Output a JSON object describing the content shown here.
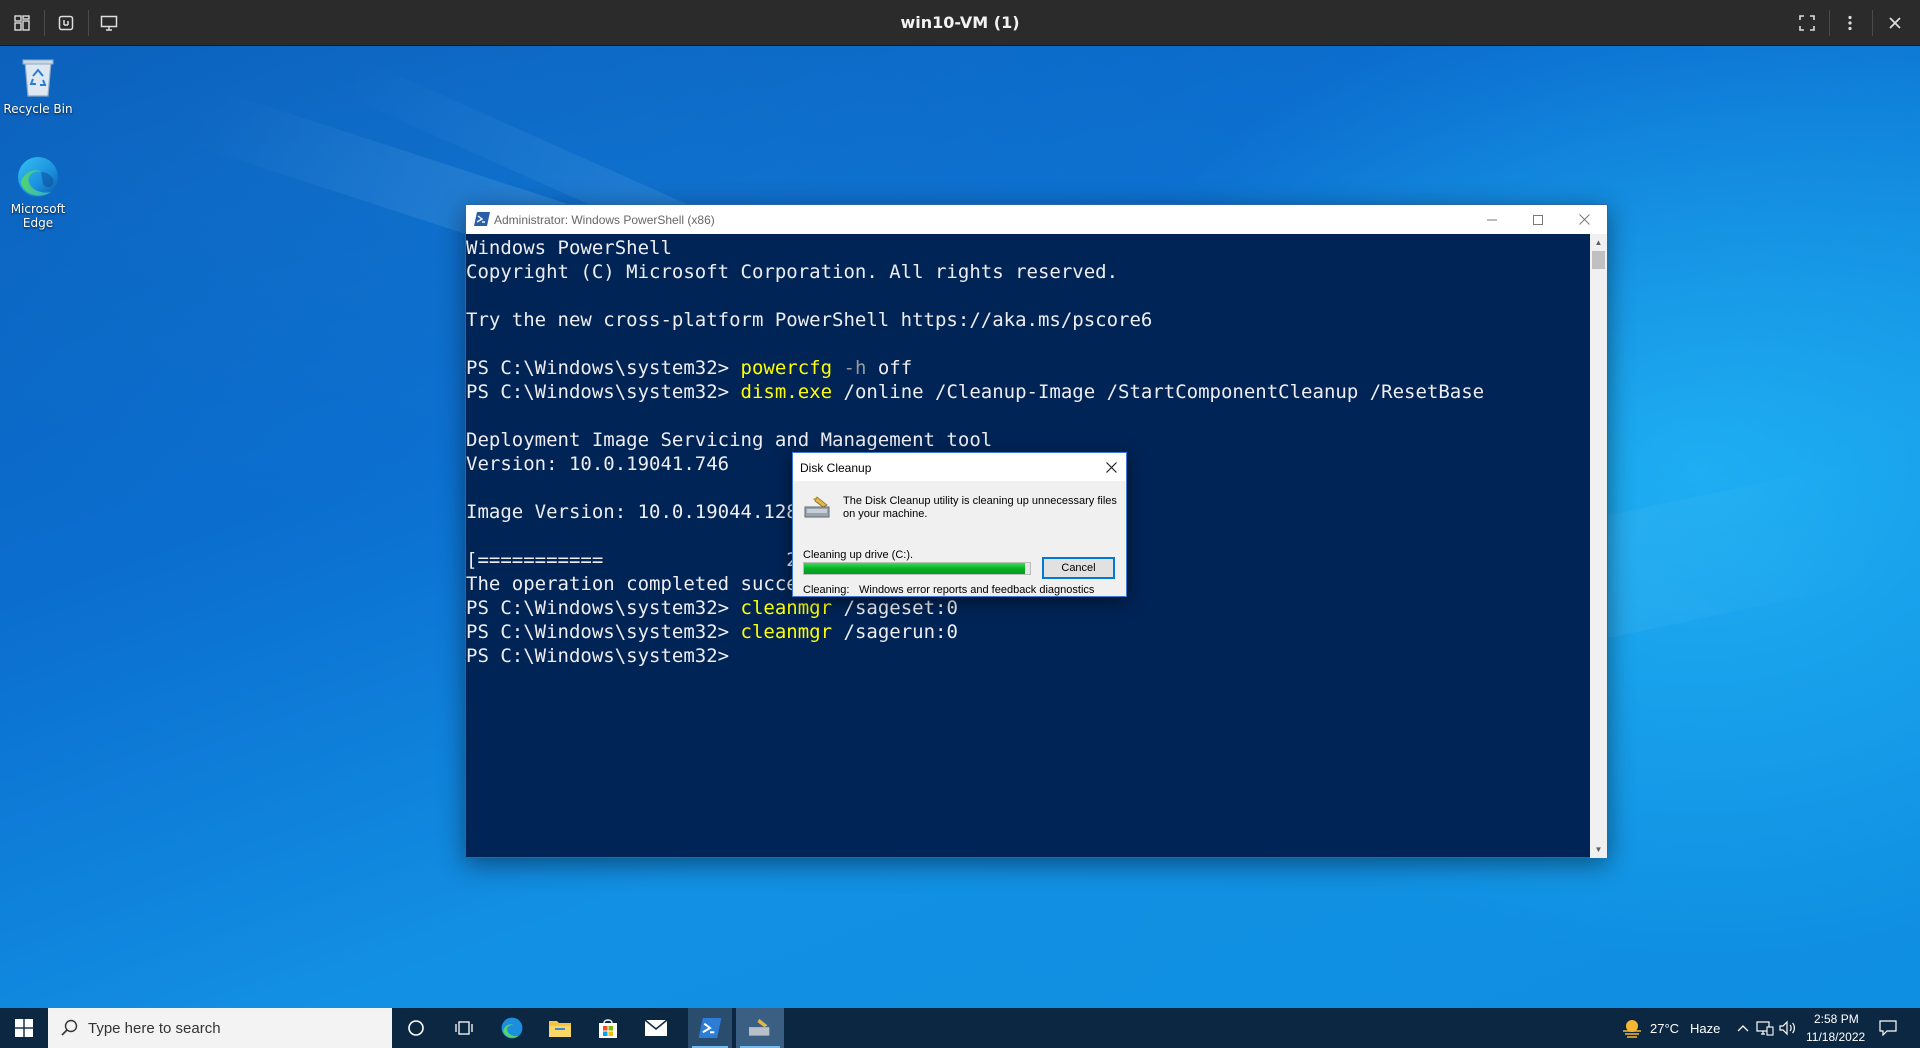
{
  "vm_bar": {
    "title": "win10-VM (1)",
    "left_icons": [
      "dashboard-icon",
      "keyboard-icon",
      "monitor-icon"
    ],
    "right_icons": [
      "fullscreen-icon",
      "more-icon",
      "close-icon"
    ]
  },
  "desktop": {
    "icons": [
      {
        "label": "Recycle Bin",
        "icon": "recycle-bin-icon"
      },
      {
        "label": "Microsoft Edge",
        "icon": "edge-icon"
      }
    ]
  },
  "powershell": {
    "title": "Administrator: Windows PowerShell (x86)",
    "lines": [
      {
        "text": "Windows PowerShell"
      },
      {
        "text": "Copyright (C) Microsoft Corporation. All rights reserved."
      },
      {
        "text": ""
      },
      {
        "text": "Try the new cross-platform PowerShell https://aka.ms/pscore6"
      },
      {
        "text": ""
      },
      {
        "prompt": "PS C:\\Windows\\system32> ",
        "cmd": "powercfg",
        "param": " -h",
        "rest": " off"
      },
      {
        "prompt": "PS C:\\Windows\\system32> ",
        "cmd": "dism.exe",
        "rest": " /online /Cleanup-Image /StartComponentCleanup /ResetBase"
      },
      {
        "text": ""
      },
      {
        "text": "Deployment Image Servicing and Management tool"
      },
      {
        "text": "Version: 10.0.19041.746"
      },
      {
        "text": ""
      },
      {
        "text": "Image Version: 10.0.19044.1288"
      },
      {
        "text": ""
      },
      {
        "text": "[===========                20"
      },
      {
        "text": "The operation completed succes"
      },
      {
        "prompt": "PS C:\\Windows\\system32> ",
        "cmd": "cleanmgr",
        "rest": " /sageset:0"
      },
      {
        "prompt": "PS C:\\Windows\\system32> ",
        "cmd": "cleanmgr",
        "rest": " /sagerun:0"
      },
      {
        "prompt": "PS C:\\Windows\\system32> "
      }
    ]
  },
  "disk_cleanup": {
    "title": "Disk Cleanup",
    "message": "The Disk Cleanup utility is cleaning up unnecessary files on your machine.",
    "drive_text": "Cleaning up drive  (C:).",
    "progress": 0.98,
    "cancel_label": "Cancel",
    "cleaning_label": "Cleaning:",
    "cleaning_value": "Windows error reports and feedback diagnostics"
  },
  "taskbar": {
    "search_placeholder": "Type here to search",
    "apps": [
      "cortana-icon",
      "task-view-icon",
      "edge-icon",
      "file-explorer-icon",
      "store-icon",
      "mail-icon",
      "powershell-icon",
      "disk-cleanup-icon"
    ],
    "weather": {
      "temp": "27°C",
      "condition": "Haze"
    },
    "time": "2:58 PM",
    "date": "11/18/2022"
  }
}
